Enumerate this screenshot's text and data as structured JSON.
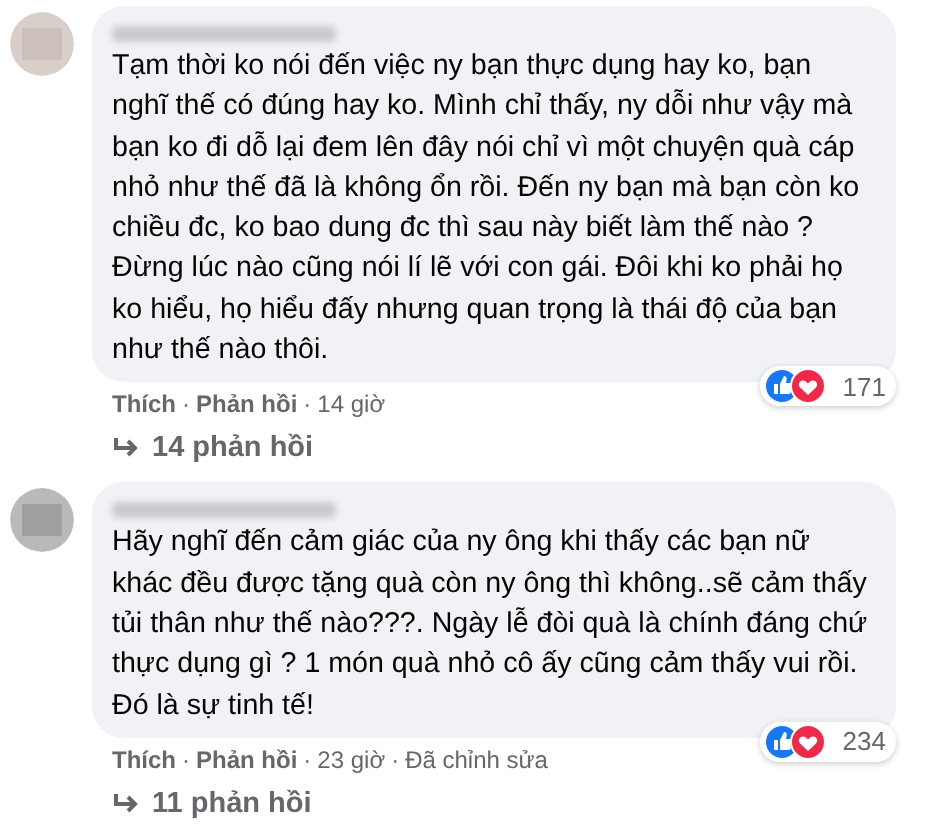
{
  "separator": "·",
  "comments": [
    {
      "text": "Tạm thời ko nói đến việc ny bạn thực dụng hay ko, bạn nghĩ thế có đúng hay ko. Mình chỉ thấy, ny dỗi như vậy mà bạn ko đi dỗ lại đem lên đây nói chỉ vì một chuyện quà cáp nhỏ như thế đã là không ổn rồi. Đến ny bạn mà bạn còn ko chiều đc, ko bao dung đc thì sau này biết làm thế nào ? Đừng lúc nào cũng nói lí lẽ với con gái. Đôi khi ko phải họ ko hiểu, họ hiểu đấy nhưng quan trọng là thái độ của bạn như thế nào thôi.",
      "actions": [
        "Thích",
        "Phản hồi",
        "14 giờ"
      ],
      "reaction_count": "171",
      "replies": "14 phản hồi"
    },
    {
      "text": "Hãy nghĩ đến cảm giác của ny ông khi thấy các bạn nữ khác đều được tặng quà còn ny ông thì không..sẽ cảm thấy tủi thân như thế nào???. Ngày lễ đòi quà là chính đáng chứ thực dụng gì ? 1 món quà nhỏ cô ấy cũng cảm thấy vui rồi. Đó là sự tinh tế!",
      "actions": [
        "Thích",
        "Phản hồi",
        "23 giờ",
        "Đã chỉnh sửa"
      ],
      "reaction_count": "234",
      "replies": "11 phản hồi"
    }
  ]
}
